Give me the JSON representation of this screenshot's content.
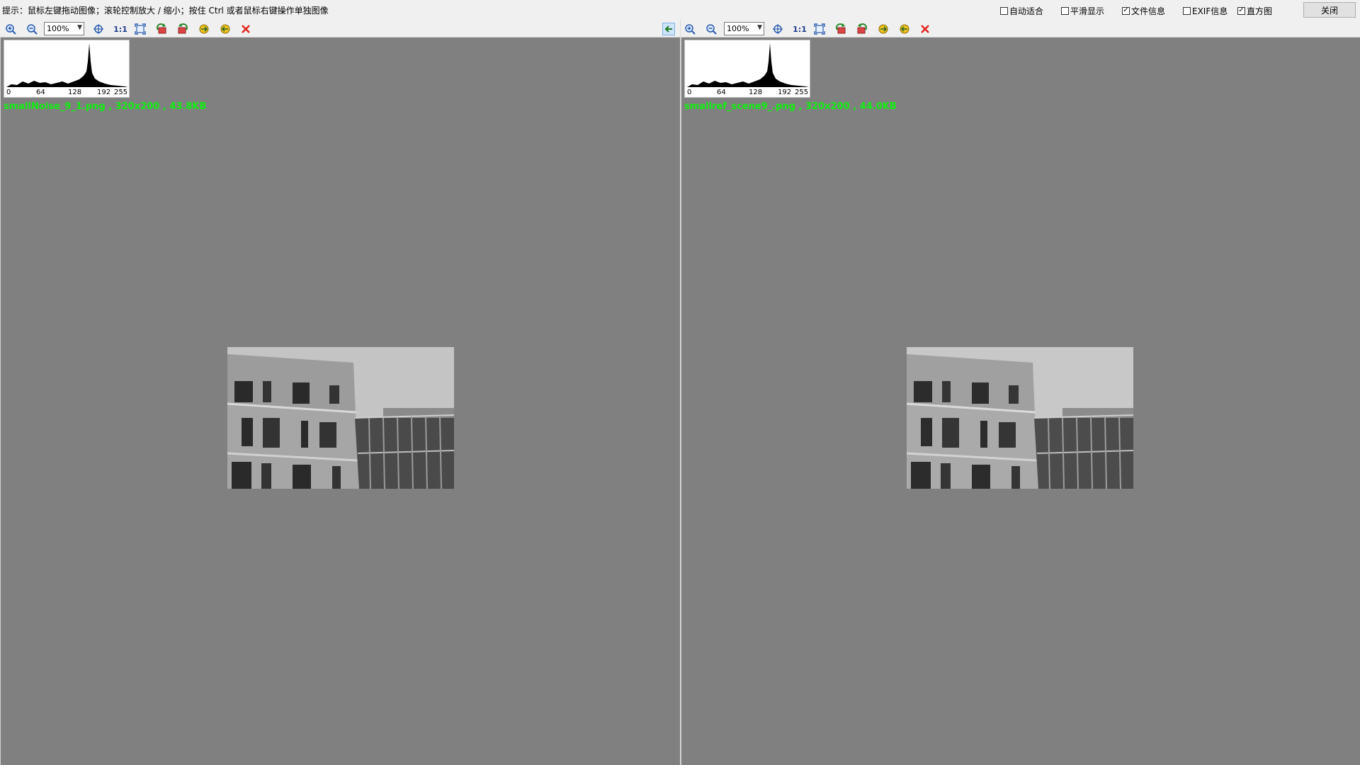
{
  "hint": "提示：鼠标左键拖动图像；滚轮控制放大 / 缩小；按住 Ctrl 或者鼠标右键操作单独图像",
  "options": [
    {
      "label": "自动适合",
      "checked": false
    },
    {
      "label": "平滑显示",
      "checked": false
    },
    {
      "label": "文件信息",
      "checked": true
    },
    {
      "label": "EXIF信息",
      "checked": false
    },
    {
      "label": "直方图",
      "checked": true
    }
  ],
  "close_label": "关闭",
  "check_mark": "✓",
  "panes": [
    {
      "zoom": "100%",
      "one_to_one": "1:1",
      "histogram_ticks": [
        "0",
        "64",
        "128",
        "192",
        "255"
      ],
      "file_info": "smallNoise_9_1.png , 320x200 , 43.8KB"
    },
    {
      "zoom": "100%",
      "one_to_one": "1:1",
      "histogram_ticks": [
        "0",
        "64",
        "128",
        "192",
        "255"
      ],
      "file_info": "smallref_scene9_.png , 320x200 , 44.0KB"
    }
  ],
  "icons": {
    "zoom_in": "magnifier-plus-icon",
    "zoom_out": "magnifier-minus-icon",
    "fit": "fit-center-icon",
    "fullscreen": "expand-frame-icon",
    "rotate_left": "rotate-left-icon",
    "rotate_right": "rotate-right-icon",
    "flip": "flip-icon",
    "save": "save-icon",
    "close": "red-x-icon",
    "sync": "blue-arrow-left-icon"
  },
  "colors": {
    "canvas_bg": "#808080",
    "file_info_text": "#11ee11",
    "close_x": "#e0241b"
  }
}
